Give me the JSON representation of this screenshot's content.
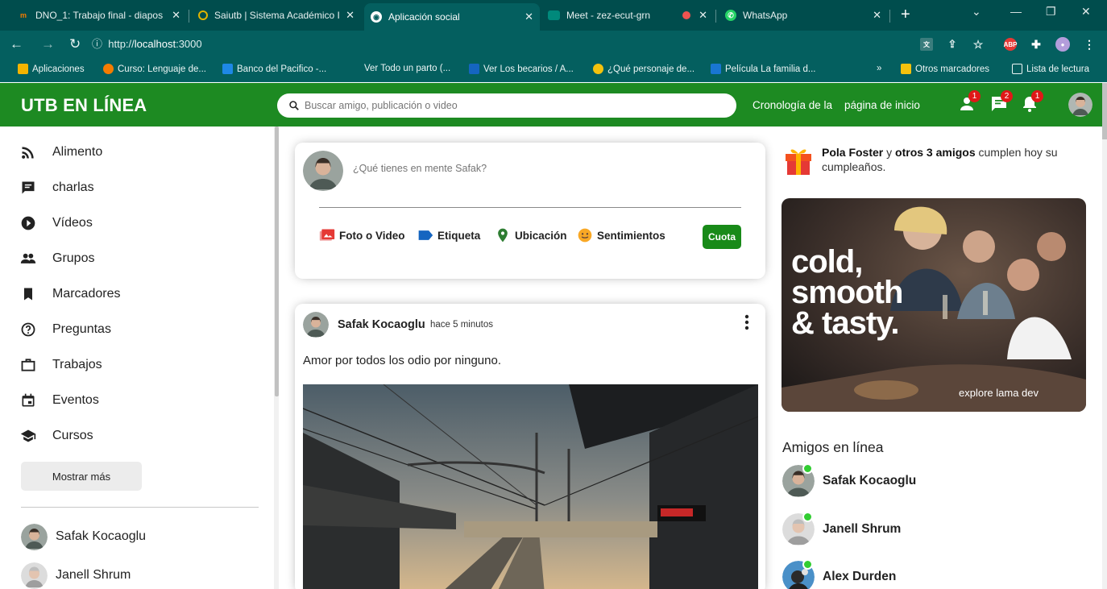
{
  "browser": {
    "tabs": [
      {
        "title": "DNO_1: Trabajo final - diapos",
        "icon": "moodle-icon",
        "color": "#f57c00"
      },
      {
        "title": "Saiutb | Sistema Académico I",
        "icon": "saiutb-icon",
        "color": "#e0b400"
      },
      {
        "title": "Aplicación social",
        "icon": "globe-icon",
        "color": "#ffffff"
      },
      {
        "title": "Meet - zez-ecut-grn",
        "icon": "meet-icon",
        "color": "#00897b"
      },
      {
        "title": "WhatsApp",
        "icon": "whatsapp-icon",
        "color": "#25d366"
      }
    ],
    "url_prefix": "http://",
    "url_host": "localhost",
    "url_suffix": ":3000",
    "bookmarks": [
      {
        "label": "Aplicaciones",
        "color": "#f4b400"
      },
      {
        "label": "Curso: Lenguaje de...",
        "color": "#f57c00"
      },
      {
        "label": "Banco del Pacifico -...",
        "color": "#1e88e5"
      },
      {
        "label": "Ver Todo un parto (...",
        "color": "#045f5f"
      },
      {
        "label": "Ver Los becarios / A...",
        "color": "#1565c0"
      },
      {
        "label": "¿Qué personaje de...",
        "color": "#f4c20d"
      },
      {
        "label": "Película La familia d...",
        "color": "#1976d2"
      },
      {
        "label": "»",
        "color": "#045f5f"
      },
      {
        "label": "Otros marcadores",
        "color": "#f4c20d"
      },
      {
        "label": "Lista de lectura",
        "color": "#045f5f"
      }
    ]
  },
  "header": {
    "logo": "UTB EN LÍNEA",
    "search_placeholder": "Buscar amigo, publicación o video",
    "link_timeline": "Cronología de la",
    "link_home": "página de inicio",
    "badges": {
      "friends": "1",
      "chat": "2",
      "notifications": "1"
    },
    "brand_color": "#1d8a22"
  },
  "sidebar": {
    "items": [
      {
        "label": "Alimento",
        "icon": "rss-feed-icon"
      },
      {
        "label": "charlas",
        "icon": "chat-icon"
      },
      {
        "label": "Vídeos",
        "icon": "play-circle-icon"
      },
      {
        "label": "Grupos",
        "icon": "group-icon"
      },
      {
        "label": "Marcadores",
        "icon": "bookmark-icon"
      },
      {
        "label": "Preguntas",
        "icon": "help-outline-icon"
      },
      {
        "label": "Trabajos",
        "icon": "work-outline-icon"
      },
      {
        "label": "Eventos",
        "icon": "event-icon"
      },
      {
        "label": "Cursos",
        "icon": "school-icon"
      }
    ],
    "show_more": "Mostrar más",
    "friends": [
      "Safak Kocaoglu",
      "Janell Shrum"
    ]
  },
  "share": {
    "placeholder": "¿Qué tienes en mente Safak?",
    "options": [
      {
        "label": "Foto o Video",
        "icon": "perm-media-icon",
        "color": "#e53935"
      },
      {
        "label": "Etiqueta",
        "icon": "label-icon",
        "color": "#1565c0"
      },
      {
        "label": "Ubicación",
        "icon": "room-icon",
        "color": "#2e7d32"
      },
      {
        "label": "Sentimientos",
        "icon": "emoji-emotions-icon",
        "color": "#f9a825"
      }
    ],
    "button": "Cuota"
  },
  "post": {
    "author": "Safak Kocaoglu",
    "date": "hace 5 minutos",
    "text": "Amor por todos los odio por ninguno."
  },
  "rightbar": {
    "birthday_name": "Pola Foster",
    "birthday_mid": " y ",
    "birthday_others": "otros 3 amigos",
    "birthday_tail": " cumplen hoy su cumpleaños.",
    "ad_line1": "cold,",
    "ad_line2": "smooth",
    "ad_line3": "& tasty.",
    "ad_sub": "explore lama dev",
    "online_title": "Amigos en línea",
    "online": [
      "Safak Kocaoglu",
      "Janell Shrum",
      "Alex Durden"
    ]
  }
}
